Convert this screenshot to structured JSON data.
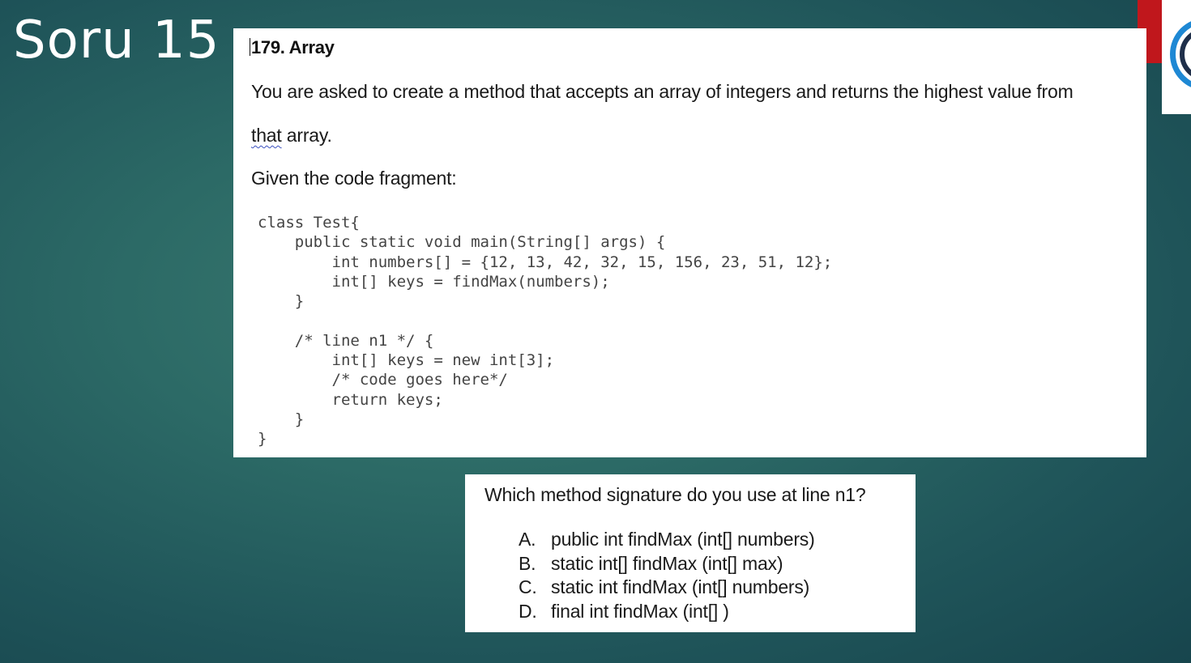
{
  "slide": {
    "title": "Soru 15",
    "colors": {
      "accent_red": "#c0171c",
      "logo_blue": "#1e88d4",
      "logo_navy": "#1f2f4a"
    },
    "logo_icon": "circular-logo-icon"
  },
  "question": {
    "heading": "179. Array",
    "description_line1": "You are asked to create a method that accepts an array of integers and returns the highest value from",
    "description_line2_word": "that",
    "description_line2_rest": " array.",
    "given": "Given the code fragment:",
    "code": "class Test{\n    public static void main(String[] args) {\n        int numbers[] = {12, 13, 42, 32, 15, 156, 23, 51, 12};\n        int[] keys = findMax(numbers);\n    }\n\n    /* line n1 */ {\n        int[] keys = new int[3];\n        /* code goes here*/\n        return keys;\n    }\n}"
  },
  "answers": {
    "prompt": "Which method signature do you use at line n1?",
    "options": [
      {
        "letter": "A.",
        "text": "public int findMax (int[] numbers)"
      },
      {
        "letter": "B.",
        "text": "static int[] findMax (int[] max)"
      },
      {
        "letter": "C.",
        "text": "static int findMax (int[] numbers)"
      },
      {
        "letter": "D.",
        "text": "final int findMax (int[] )"
      }
    ]
  }
}
